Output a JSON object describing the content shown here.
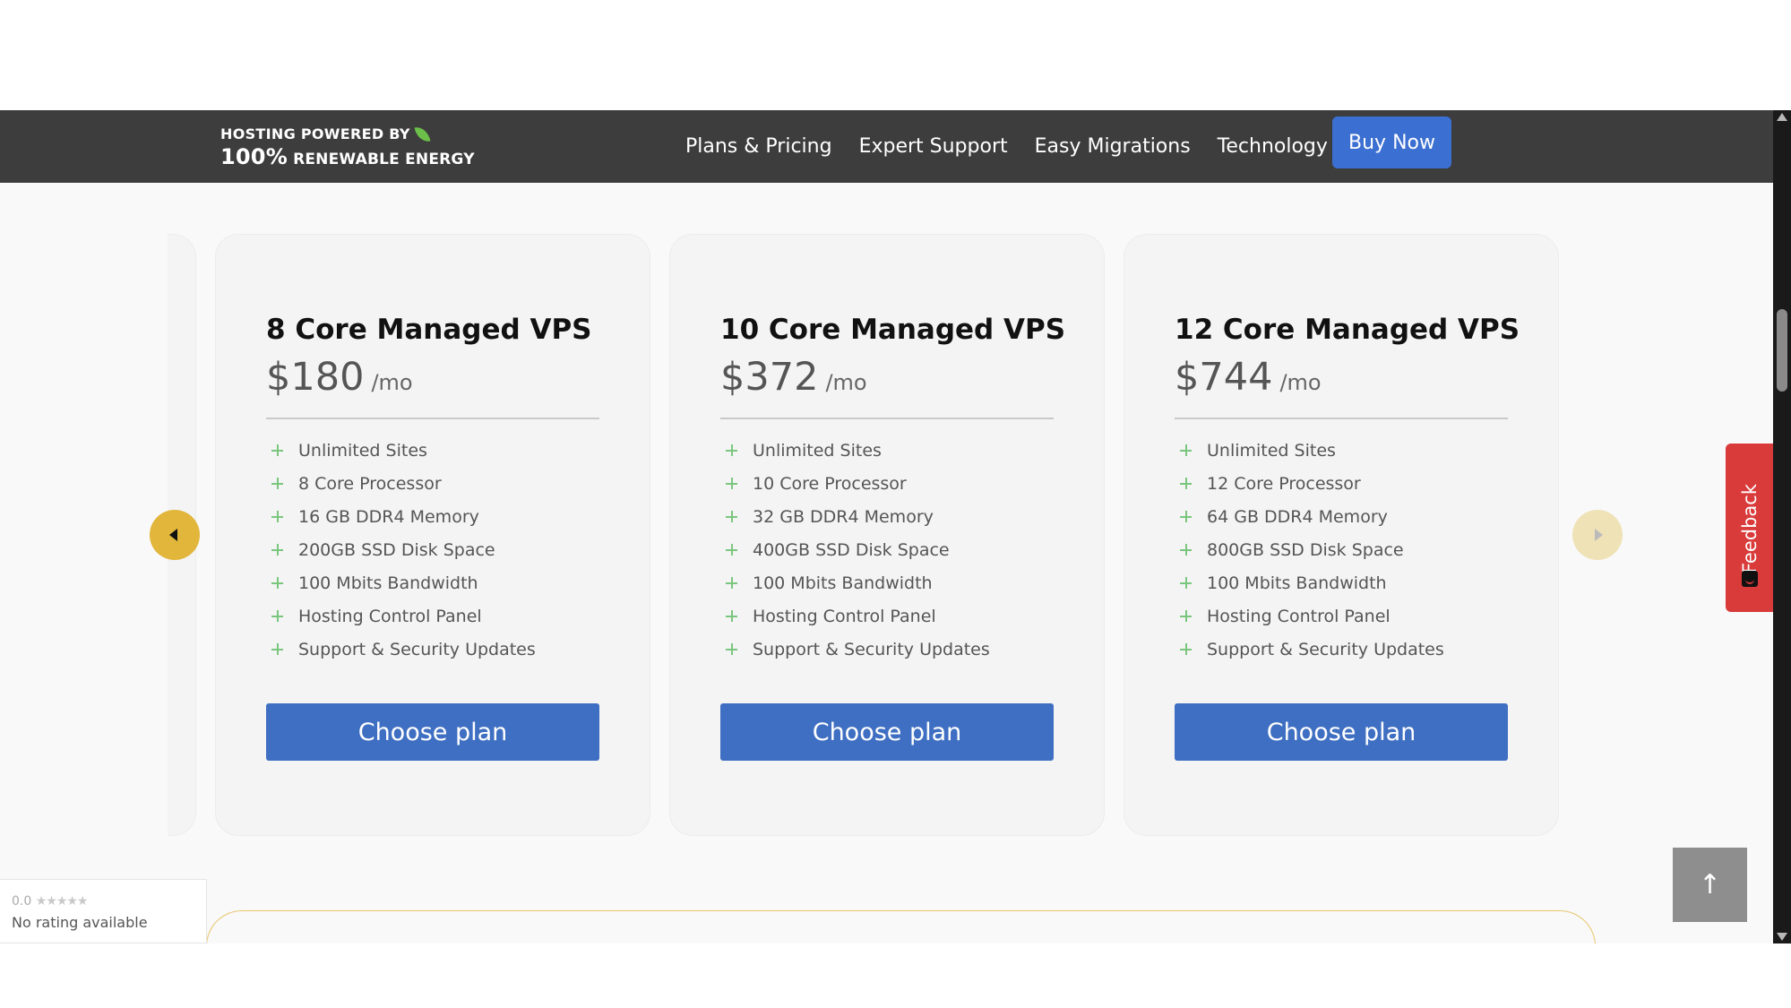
{
  "header": {
    "logo": {
      "line1": "HOSTING POWERED BY",
      "line2_big": "100%",
      "line2_rest": "RENEWABLE ENERGY"
    },
    "nav": [
      {
        "label": "Plans & Pricing"
      },
      {
        "label": "Expert Support"
      },
      {
        "label": "Easy Migrations"
      },
      {
        "label": "Technology"
      }
    ],
    "buy_now": "Buy Now"
  },
  "plans": [
    {
      "title": "8 Core Managed VPS",
      "price": "$180",
      "per": "/mo",
      "features": [
        "Unlimited Sites",
        "8 Core Processor",
        "16 GB DDR4 Memory",
        "200GB SSD Disk Space",
        "100 Mbits Bandwidth",
        "Hosting Control Panel",
        "Support & Security Updates"
      ],
      "cta": "Choose plan"
    },
    {
      "title": "10 Core Managed VPS",
      "price": "$372",
      "per": "/mo",
      "features": [
        "Unlimited Sites",
        "10 Core Processor",
        "32 GB DDR4 Memory",
        "400GB SSD Disk Space",
        "100 Mbits Bandwidth",
        "Hosting Control Panel",
        "Support & Security Updates"
      ],
      "cta": "Choose plan"
    },
    {
      "title": "12 Core Managed VPS",
      "price": "$744",
      "per": "/mo",
      "features": [
        "Unlimited Sites",
        "12 Core Processor",
        "64 GB DDR4 Memory",
        "800GB SSD Disk Space",
        "100 Mbits Bandwidth",
        "Hosting Control Panel",
        "Support & Security Updates"
      ],
      "cta": "Choose plan"
    }
  ],
  "feedback": {
    "label": "Feedback"
  },
  "back_to_top": {
    "glyph": "↑"
  },
  "rating": {
    "score": "0.0",
    "stars": "★★★★★",
    "text": "No rating available"
  },
  "colors": {
    "nav_bg": "#3d3d3d",
    "primary": "#3f6fc2",
    "accent_gold": "#e2b53b",
    "feedback_red": "#d93a3a",
    "plus_green": "#7bc67f"
  }
}
